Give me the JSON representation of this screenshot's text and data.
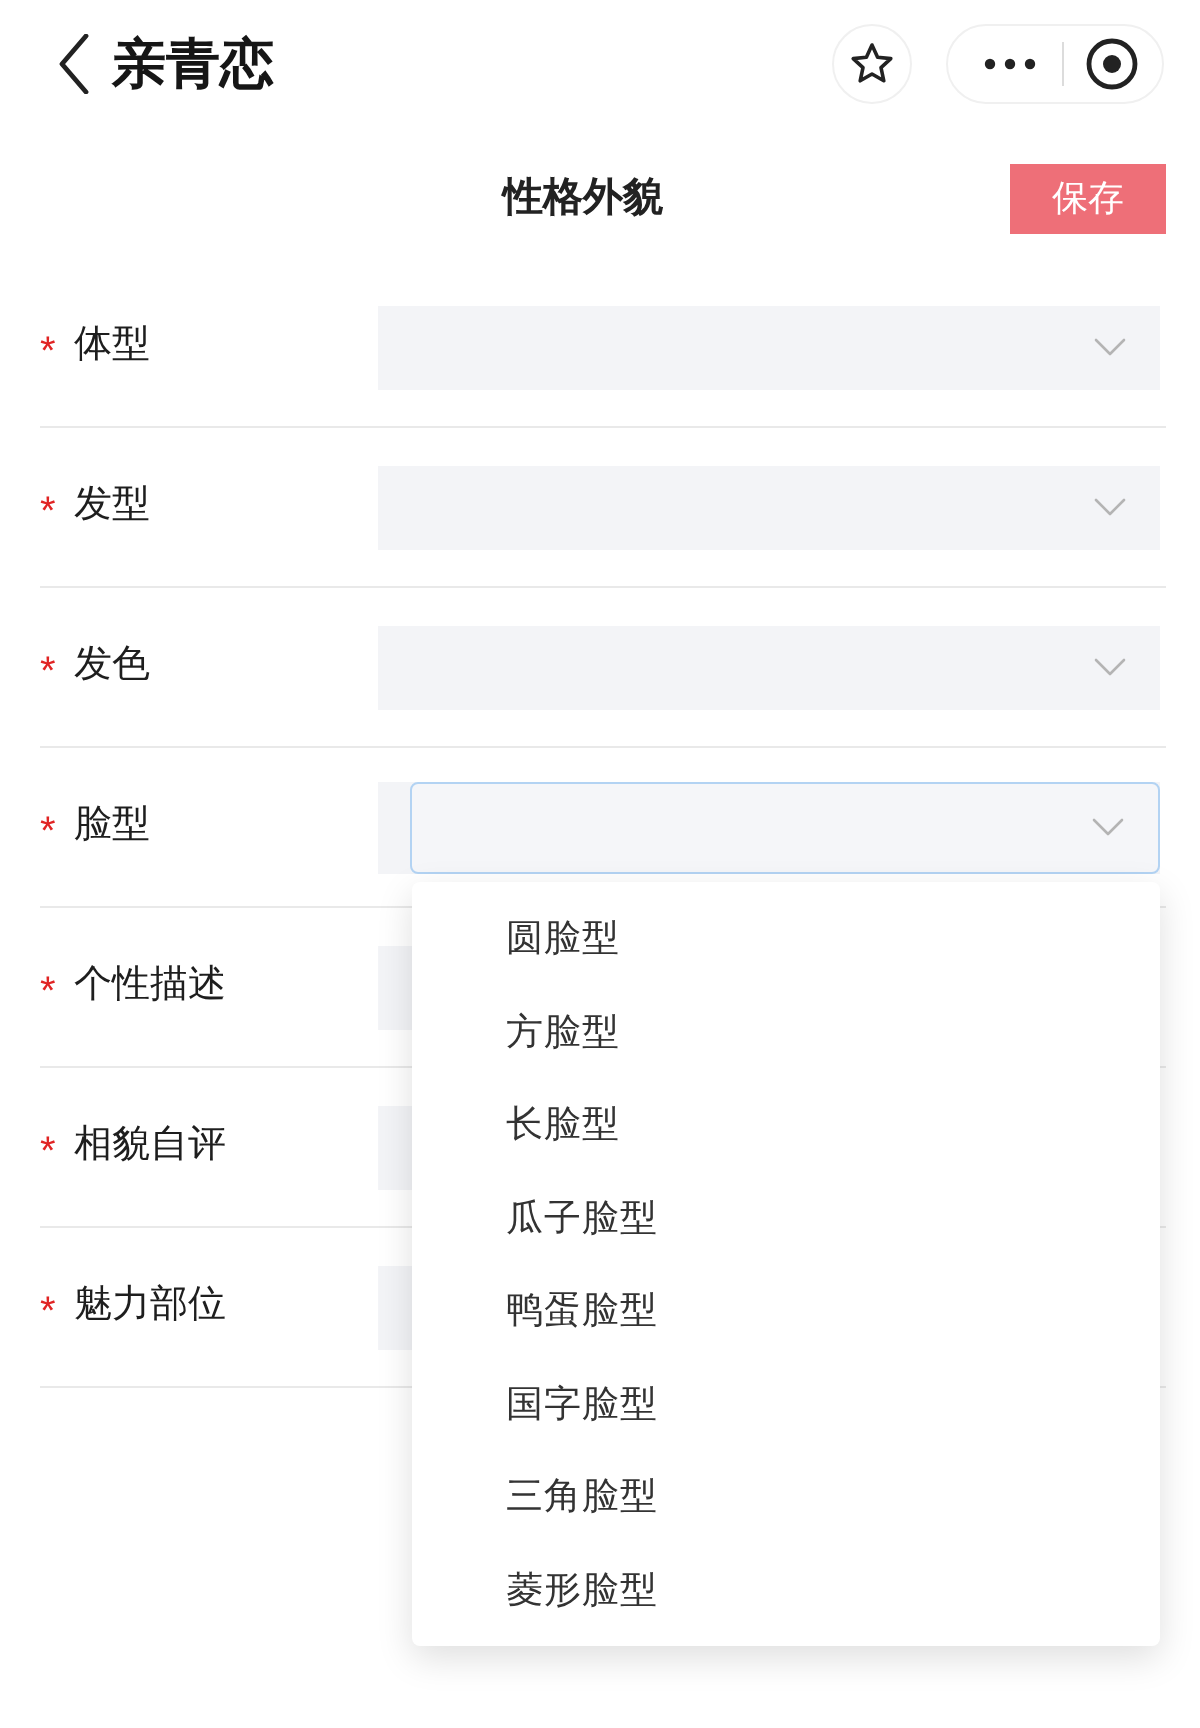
{
  "nav_bar": {
    "title": "亲青恋"
  },
  "page_header": {
    "title": "性格外貌",
    "save_button": "保存"
  },
  "fields": [
    {
      "label": "体型",
      "required_mark": "*",
      "open": false
    },
    {
      "label": "发型",
      "required_mark": "*",
      "open": false
    },
    {
      "label": "发色",
      "required_mark": "*",
      "open": false
    },
    {
      "label": "脸型",
      "required_mark": "*",
      "open": true,
      "options": [
        {
          "label": "圆脸型",
          "selected": false
        },
        {
          "label": "方脸型",
          "selected": false
        },
        {
          "label": "长脸型",
          "selected": false
        },
        {
          "label": "瓜子脸型",
          "selected": false
        },
        {
          "label": "鸭蛋脸型",
          "selected": false
        },
        {
          "label": "国字脸型",
          "selected": false
        },
        {
          "label": "三角脸型",
          "selected": false
        },
        {
          "label": "菱形脸型",
          "selected": false
        }
      ]
    },
    {
      "label": "个性描述",
      "required_mark": "*",
      "open": false
    },
    {
      "label": "相貌自评",
      "required_mark": "*",
      "open": false
    },
    {
      "label": "魅力部位",
      "required_mark": "*",
      "open": false
    }
  ]
}
